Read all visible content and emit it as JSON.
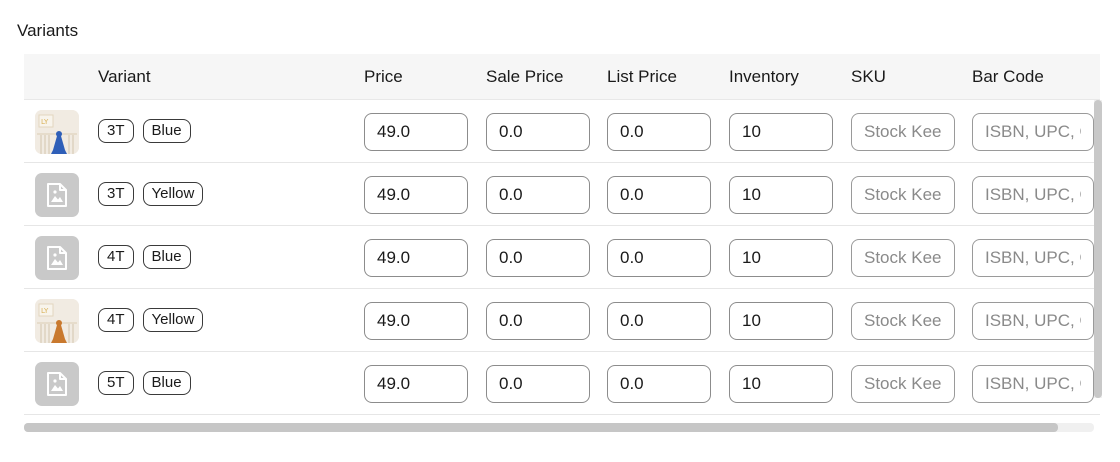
{
  "section": {
    "title": "Variants"
  },
  "table": {
    "columns": [
      "Variant",
      "Price",
      "Sale Price",
      "List Price",
      "Inventory",
      "SKU",
      "Bar Code"
    ],
    "placeholders": {
      "sku": "Stock Keeping Unit",
      "barcode": "ISBN, UPC, GTIN"
    },
    "rows": [
      {
        "image": "product-photo-blue",
        "size": "3T",
        "color": "Blue",
        "price": "49.0",
        "sale_price": "0.0",
        "list_price": "0.0",
        "inventory": "10",
        "sku": "",
        "barcode": ""
      },
      {
        "image": "image-placeholder",
        "size": "3T",
        "color": "Yellow",
        "price": "49.0",
        "sale_price": "0.0",
        "list_price": "0.0",
        "inventory": "10",
        "sku": "",
        "barcode": ""
      },
      {
        "image": "image-placeholder",
        "size": "4T",
        "color": "Blue",
        "price": "49.0",
        "sale_price": "0.0",
        "list_price": "0.0",
        "inventory": "10",
        "sku": "",
        "barcode": ""
      },
      {
        "image": "product-photo-yellow",
        "size": "4T",
        "color": "Yellow",
        "price": "49.0",
        "sale_price": "0.0",
        "list_price": "0.0",
        "inventory": "10",
        "sku": "",
        "barcode": ""
      },
      {
        "image": "image-placeholder",
        "size": "5T",
        "color": "Blue",
        "price": "49.0",
        "sale_price": "0.0",
        "list_price": "0.0",
        "inventory": "10",
        "sku": "",
        "barcode": ""
      }
    ]
  }
}
